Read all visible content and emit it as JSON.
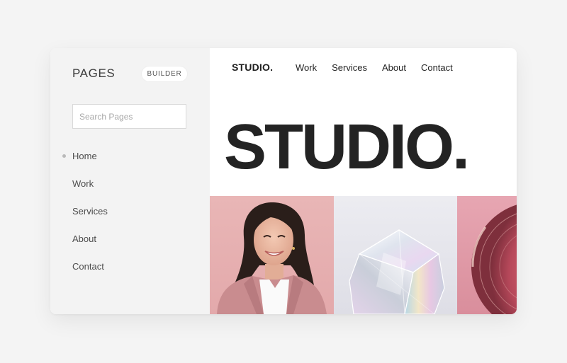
{
  "sidebar": {
    "title": "PAGES",
    "badge": "BUILDER",
    "search": {
      "placeholder": "Search Pages",
      "value": ""
    },
    "items": [
      {
        "label": "Home",
        "active": true
      },
      {
        "label": "Work",
        "active": false
      },
      {
        "label": "Services",
        "active": false
      },
      {
        "label": "About",
        "active": false
      },
      {
        "label": "Contact",
        "active": false
      }
    ]
  },
  "preview": {
    "logo": "STUDIO.",
    "nav": [
      "Work",
      "Services",
      "About",
      "Contact"
    ],
    "hero_title": "STUDIO.",
    "tiles": [
      {
        "icon": "portrait-photo"
      },
      {
        "icon": "glass-cube-photo"
      },
      {
        "icon": "vinyl-disc-photo"
      }
    ]
  },
  "colors": {
    "background": "#f4f4f4",
    "sidebar": "#f3f3f3",
    "text_dark": "#232323",
    "pink_tile": "#e9b6b6"
  }
}
